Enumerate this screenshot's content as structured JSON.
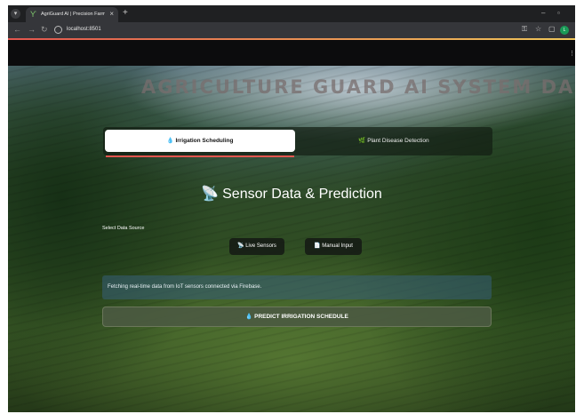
{
  "browser": {
    "tab_title": "AgriGuard AI | Precision Farmi...",
    "url": "localhost:8501",
    "profile_initial": "L"
  },
  "app": {
    "hero_title": "AGRICULTURE GUARD AI SYSTEM DASH",
    "tabs": [
      {
        "label": "💧 Irrigation Scheduling",
        "active": true
      },
      {
        "label": "🌿 Plant Disease Detection",
        "active": false
      }
    ],
    "section_icon": "📡",
    "section_title": "Sensor Data & Prediction",
    "data_source_label": "Select Data Source",
    "buttons": {
      "live": "📡 Live Sensors",
      "manual": "📄 Manual Input",
      "predict": "💧 PREDICT IRRIGATION SCHEDULE"
    },
    "info_text": "Fetching real-time data from IoT sensors connected via Firebase.",
    "accent_color": "#e2564f"
  }
}
